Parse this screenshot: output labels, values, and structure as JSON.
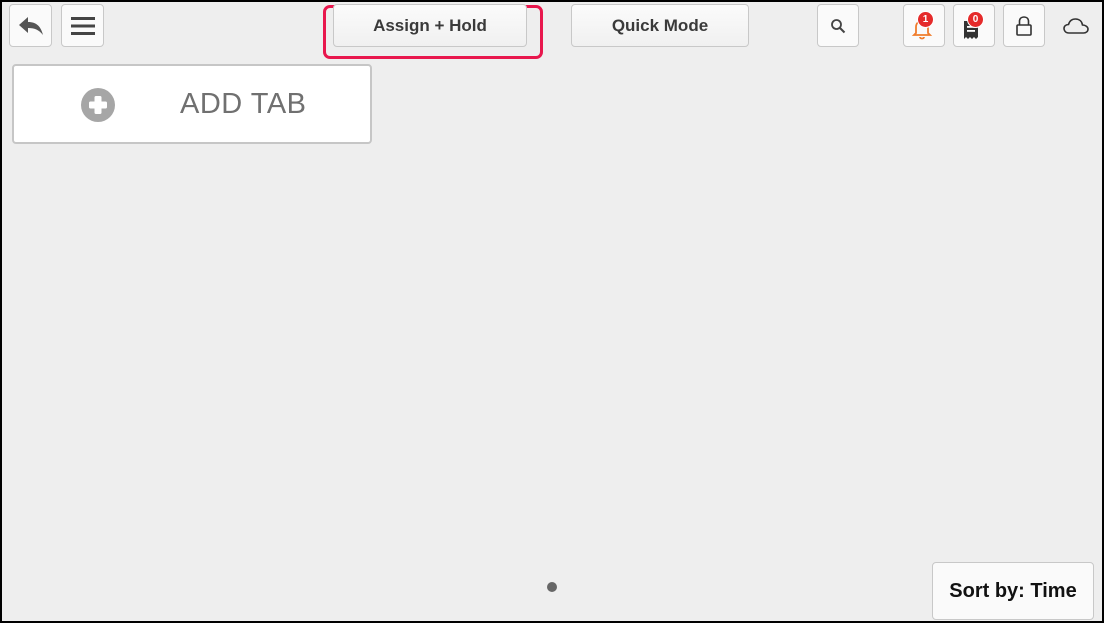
{
  "toolbar": {
    "back_icon": "reply-arrow-icon",
    "menu_icon": "hamburger-menu-icon",
    "assign_hold_label": "Assign + Hold",
    "quick_mode_label": "Quick Mode",
    "search_icon": "search-icon",
    "notifications": {
      "icon": "bell-icon",
      "count": "1",
      "color": "#f07c2b"
    },
    "receipts": {
      "icon": "receipt-icon",
      "count": "0"
    },
    "lock_icon": "lock-icon",
    "cloud_icon": "cloud-icon",
    "highlight_color": "#e8174d",
    "badge_color": "#e52b2b"
  },
  "main": {
    "add_tab_label": "ADD TAB",
    "add_tab_icon": "plus-circle-icon"
  },
  "footer": {
    "sort_label": "Sort by: Time",
    "page_indicator": {
      "current": 1,
      "total": 1
    }
  }
}
